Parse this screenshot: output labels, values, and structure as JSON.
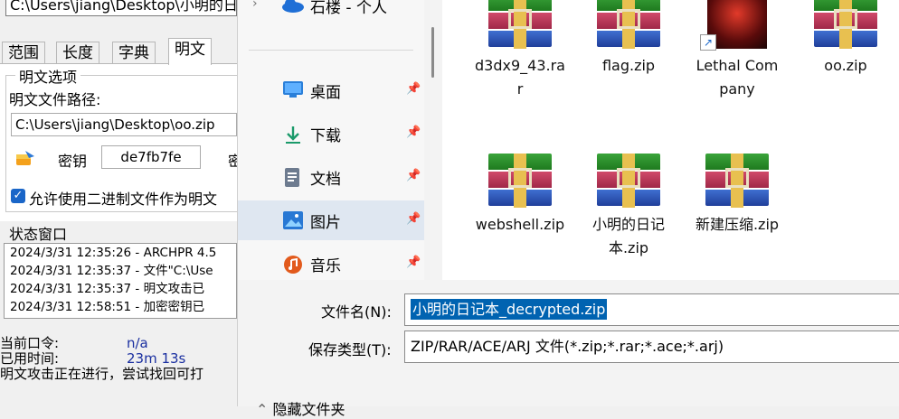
{
  "left_window": {
    "top_path": "C:\\Users\\jiang\\Desktop\\小明的日",
    "tabs": [
      "范围",
      "长度",
      "字典",
      "明文"
    ],
    "active_tab": "明文",
    "group_title": "明文选项",
    "plaintext_path_label": "明文文件路径:",
    "plaintext_path_value": "C:\\Users\\jiang\\Desktop\\oo.zip",
    "key_label": "密钥",
    "key_value": "de7fb7fe",
    "key_extra": "密",
    "allow_binary_label": "允许使用二进制文件作为明文",
    "status_title": "状态窗口",
    "log_lines": [
      "2024/3/31 12:35:26 - ARCHPR 4.5",
      "2024/3/31 12:35:37 - 文件\"C:\\Use",
      "2024/3/31 12:35:37 - 明文攻击已",
      "2024/3/31 12:58:51 - 加密密钥已"
    ],
    "current_password_label": "当前口令:",
    "current_password_value": "n/a",
    "elapsed_label": "已用时间:",
    "elapsed_value": "23m 13s",
    "progress_text": "明文攻击正在进行，尝试找回可打"
  },
  "dialog": {
    "nav_top_label": "石楼 - 个人",
    "nav_items": [
      {
        "label": "桌面",
        "icon": "desktop-icon"
      },
      {
        "label": "下载",
        "icon": "download-icon"
      },
      {
        "label": "文档",
        "icon": "document-icon"
      },
      {
        "label": "图片",
        "icon": "pictures-icon"
      },
      {
        "label": "音乐",
        "icon": "music-icon"
      }
    ],
    "selected_nav": "图片",
    "files": [
      {
        "name": "d3dx9_43.rar",
        "icon": "winrar-icon"
      },
      {
        "name": "flag.zip",
        "icon": "winrar-icon"
      },
      {
        "name": "Lethal Company",
        "icon": "game-shortcut-icon"
      },
      {
        "name": "oo.zip",
        "icon": "winrar-icon"
      },
      {
        "name": "webshell.zip",
        "icon": "winrar-icon"
      },
      {
        "name": "小明的日记本.zip",
        "icon": "winrar-icon"
      },
      {
        "name": "新建压缩.zip",
        "icon": "winrar-icon"
      }
    ],
    "filename_label": "文件名(N):",
    "filename_value": "小明的日记本_decrypted.zip",
    "filetype_label": "保存类型(T):",
    "filetype_value": "ZIP/RAR/ACE/ARJ 文件(*.zip;*.rar;*.ace;*.arj)",
    "hide_folders_label": "隐藏文件夹"
  }
}
